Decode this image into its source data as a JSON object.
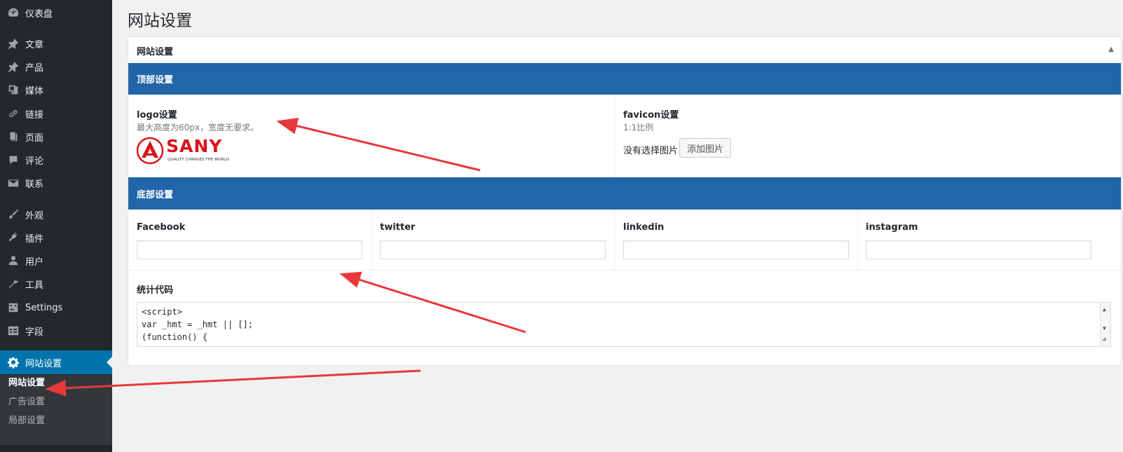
{
  "sidebar": {
    "items": [
      {
        "label": "仪表盘",
        "icon": "dashboard-icon"
      },
      {
        "label": "文章",
        "icon": "pushpin-icon"
      },
      {
        "label": "产品",
        "icon": "pushpin-icon"
      },
      {
        "label": "媒体",
        "icon": "media-icon"
      },
      {
        "label": "链接",
        "icon": "link-icon"
      },
      {
        "label": "页面",
        "icon": "page-icon"
      },
      {
        "label": "评论",
        "icon": "comment-icon"
      },
      {
        "label": "联系",
        "icon": "mail-icon"
      },
      {
        "label": "外观",
        "icon": "brush-icon"
      },
      {
        "label": "插件",
        "icon": "plugin-icon"
      },
      {
        "label": "用户",
        "icon": "user-icon"
      },
      {
        "label": "工具",
        "icon": "wrench-icon"
      },
      {
        "label": "Settings",
        "icon": "settings-sliders-icon"
      },
      {
        "label": "字段",
        "icon": "table-icon"
      },
      {
        "label": "网站设置",
        "icon": "gear-icon"
      }
    ],
    "submenu": [
      "网站设置",
      "广告设置",
      "局部设置"
    ]
  },
  "page": {
    "title": "网站设置"
  },
  "panel": {
    "title": "网站设置",
    "top_section": "顶部设置",
    "logo": {
      "label": "logo设置",
      "desc": "最大高度为60px，宽度无要求。",
      "brand": "SANY",
      "tagline": "QUALITY CHANGES THE WORLD"
    },
    "favicon": {
      "label": "favicon设置",
      "desc": "1:1比例",
      "status": "没有选择图片",
      "button": "添加图片"
    },
    "bottom_section": "底部设置",
    "social": [
      {
        "label": "Facebook",
        "value": ""
      },
      {
        "label": "twitter",
        "value": ""
      },
      {
        "label": "linkedin",
        "value": ""
      },
      {
        "label": "instagram",
        "value": ""
      }
    ],
    "stats": {
      "label": "统计代码",
      "lines": [
        "<script>",
        "var _hmt = _hmt || [];",
        "(function() {"
      ]
    }
  },
  "colors": {
    "sidebar": "#23282d",
    "accent": "#0073aa",
    "band": "#2265a8",
    "arrow": "#e8373b",
    "logo": "#d7141a"
  }
}
